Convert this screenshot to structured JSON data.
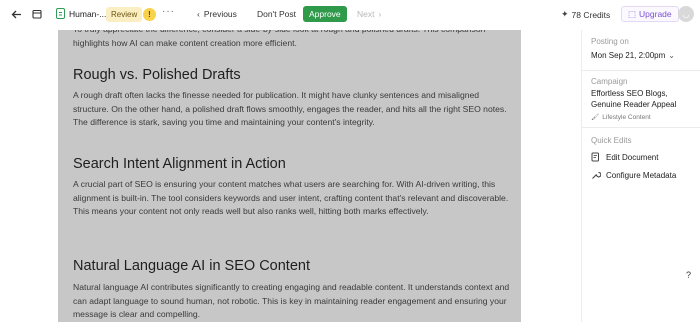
{
  "toolbar": {
    "doc_title": "Human-...",
    "review_badge": "Review",
    "previous_label": "Previous",
    "dont_post_label": "Don't Post",
    "approve_label": "Approve",
    "next_label": "Next",
    "credits_label": "78 Credits",
    "upgrade_label": "Upgrade",
    "approve_color": "#2e9a4a",
    "upgrade_color": "#7a4fd6",
    "review_badge_color": "#fbeec3",
    "icons": [
      "back-arrow-icon",
      "calendar-icon",
      "document-icon",
      "warning-icon",
      "more-icon",
      "chevron-left-icon",
      "chevron-right-icon",
      "sparkle-icon",
      "upgrade-icon"
    ]
  },
  "document": {
    "intro_paragraph": "To truly appreciate the difference, consider a side-by-side look at rough and polished drafts. This comparison highlights how AI can make content creation more efficient.",
    "sections": [
      {
        "heading": "Rough vs. Polished Drafts",
        "body": "A rough draft often lacks the finesse needed for publication. It might have clunky sentences and misaligned structure. On the other hand, a polished draft flows smoothly, engages the reader, and hits all the right SEO notes. The difference is stark, saving you time and maintaining your content's integrity."
      },
      {
        "heading": "Search Intent Alignment in Action",
        "body": "A crucial part of SEO is ensuring your content matches what users are searching for. With AI-driven writing, this alignment is built-in. The tool considers keywords and user intent, crafting content that's relevant and discoverable. This means your content not only reads well but also ranks well, hitting both marks effectively."
      },
      {
        "heading": "Natural Language AI in SEO Content",
        "body": "Natural language AI contributes significantly to creating engaging and readable content. It understands context and can adapt language to sound human, not robotic. This is key in maintaining reader engagement and ensuring your message is clear and compelling."
      }
    ]
  },
  "sidebar": {
    "posting_on_label": "Posting on",
    "posting_on_value": "Mon Sep 21, 2:00pm",
    "campaign_label": "Campaign",
    "campaign_name": "Effortless SEO Blogs, Genuine Reader Appeal",
    "campaign_tag": "Lifestyle Content",
    "quick_edits_label": "Quick Edits",
    "edit_document_label": "Edit Document",
    "configure_metadata_label": "Configure Metadata"
  },
  "help_label": "?"
}
